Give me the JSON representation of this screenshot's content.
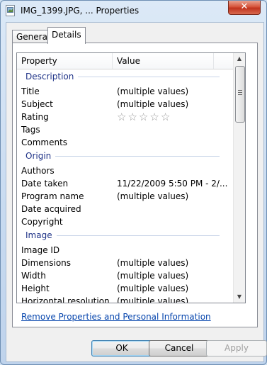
{
  "window": {
    "title": "IMG_1399.JPG, ... Properties",
    "close_glyph": "✕"
  },
  "tabs": [
    {
      "label": "General",
      "selected": false
    },
    {
      "label": "Details",
      "selected": true
    }
  ],
  "list": {
    "columns": {
      "property": "Property",
      "value": "Value"
    },
    "groups": {
      "description": "Description",
      "origin": "Origin",
      "image": "Image"
    },
    "description_rows": [
      {
        "k": "Title",
        "v": "(multiple values)"
      },
      {
        "k": "Subject",
        "v": "(multiple values)"
      },
      {
        "k": "Rating",
        "v": ""
      },
      {
        "k": "Tags",
        "v": ""
      },
      {
        "k": "Comments",
        "v": ""
      }
    ],
    "rating": {
      "stars": 5,
      "filled": 0
    },
    "origin_rows": [
      {
        "k": "Authors",
        "v": ""
      },
      {
        "k": "Date taken",
        "v": "11/22/2009 5:50 PM - 2/..."
      },
      {
        "k": "Program name",
        "v": "(multiple values)"
      },
      {
        "k": "Date acquired",
        "v": ""
      },
      {
        "k": "Copyright",
        "v": ""
      }
    ],
    "image_rows": [
      {
        "k": "Image ID",
        "v": ""
      },
      {
        "k": "Dimensions",
        "v": "(multiple values)"
      },
      {
        "k": "Width",
        "v": "(multiple values)"
      },
      {
        "k": "Height",
        "v": "(multiple values)"
      },
      {
        "k": "Horizontal resolution",
        "v": "(multiple values)"
      }
    ]
  },
  "remove_link": "Remove Properties and Personal Information",
  "buttons": {
    "ok": "OK",
    "cancel": "Cancel",
    "apply": "Apply",
    "apply_enabled": false
  }
}
